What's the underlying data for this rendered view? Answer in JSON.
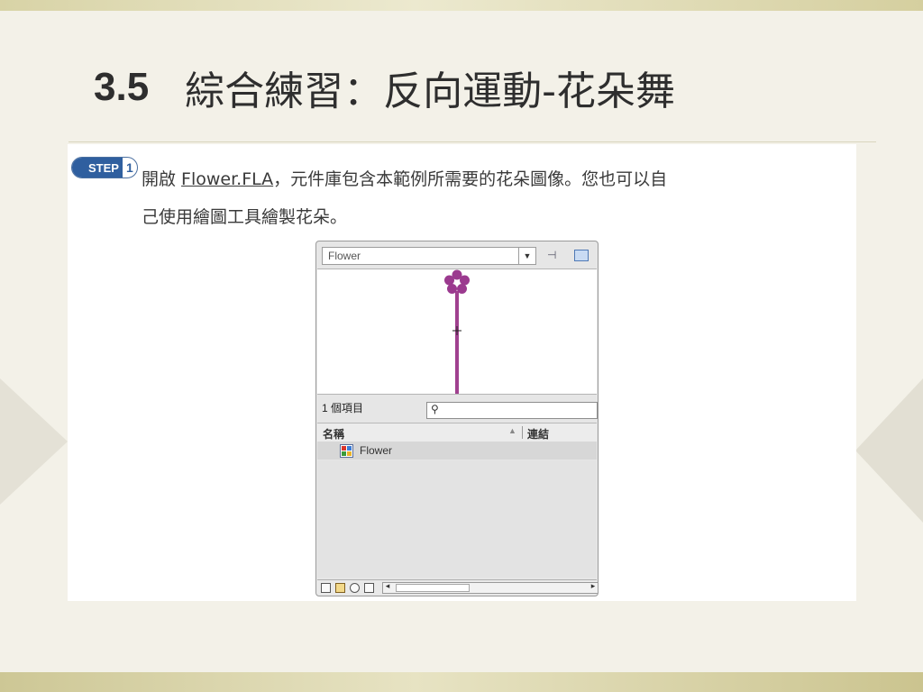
{
  "slide": {
    "number": "3.5",
    "title": "綜合練習：反向運動-花朵舞"
  },
  "step": {
    "badge_label": "STEP",
    "badge_number": "1",
    "text_before": "開啟 ",
    "file_name": "Flower.FLA",
    "text_after": "，元件庫包含本範例所需要的花朵圖像。您也可以自",
    "line2": "己使用繪圖工具繪製花朵。"
  },
  "library": {
    "selected_library": "Flower",
    "item_count": "1 個項目",
    "search_placeholder": "",
    "column_name": "名稱",
    "column_link": "連結",
    "items": [
      {
        "name": "Flower",
        "icon": "movieclip-symbol-icon"
      }
    ],
    "colors": {
      "flower": "#9b3a8f",
      "stem": "#a0418f"
    }
  }
}
